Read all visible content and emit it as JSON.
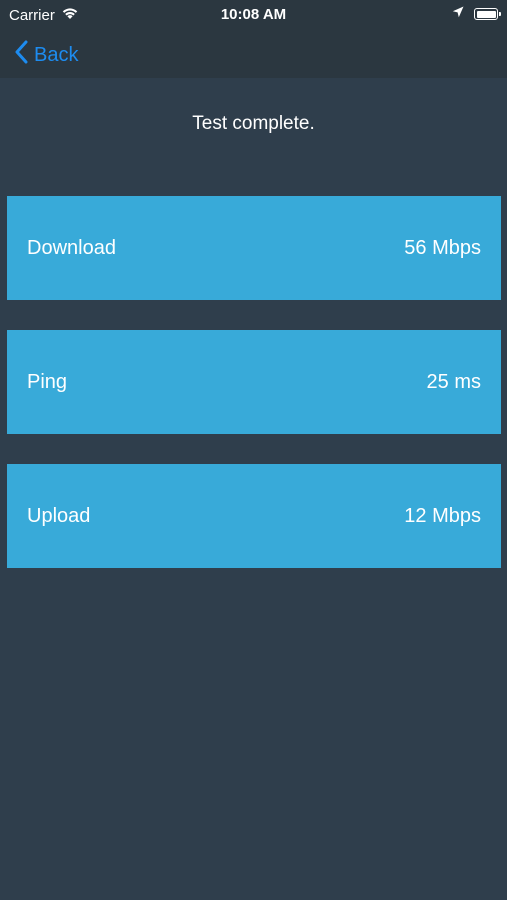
{
  "status_bar": {
    "carrier": "Carrier",
    "time": "10:08 AM",
    "icons": [
      "wifi-icon",
      "location-arrow-icon",
      "battery-icon"
    ]
  },
  "nav": {
    "back_label": "Back",
    "back_icon": "chevron-left-icon"
  },
  "main": {
    "status_text": "Test complete.",
    "results": [
      {
        "label": "Download",
        "value": "56 Mbps"
      },
      {
        "label": "Ping",
        "value": "25 ms"
      },
      {
        "label": "Upload",
        "value": "12 Mbps"
      }
    ]
  },
  "colors": {
    "background": "#2f3e4c",
    "bar_background": "#2b3740",
    "card": "#38aad9",
    "accent": "#1d8cf0"
  }
}
